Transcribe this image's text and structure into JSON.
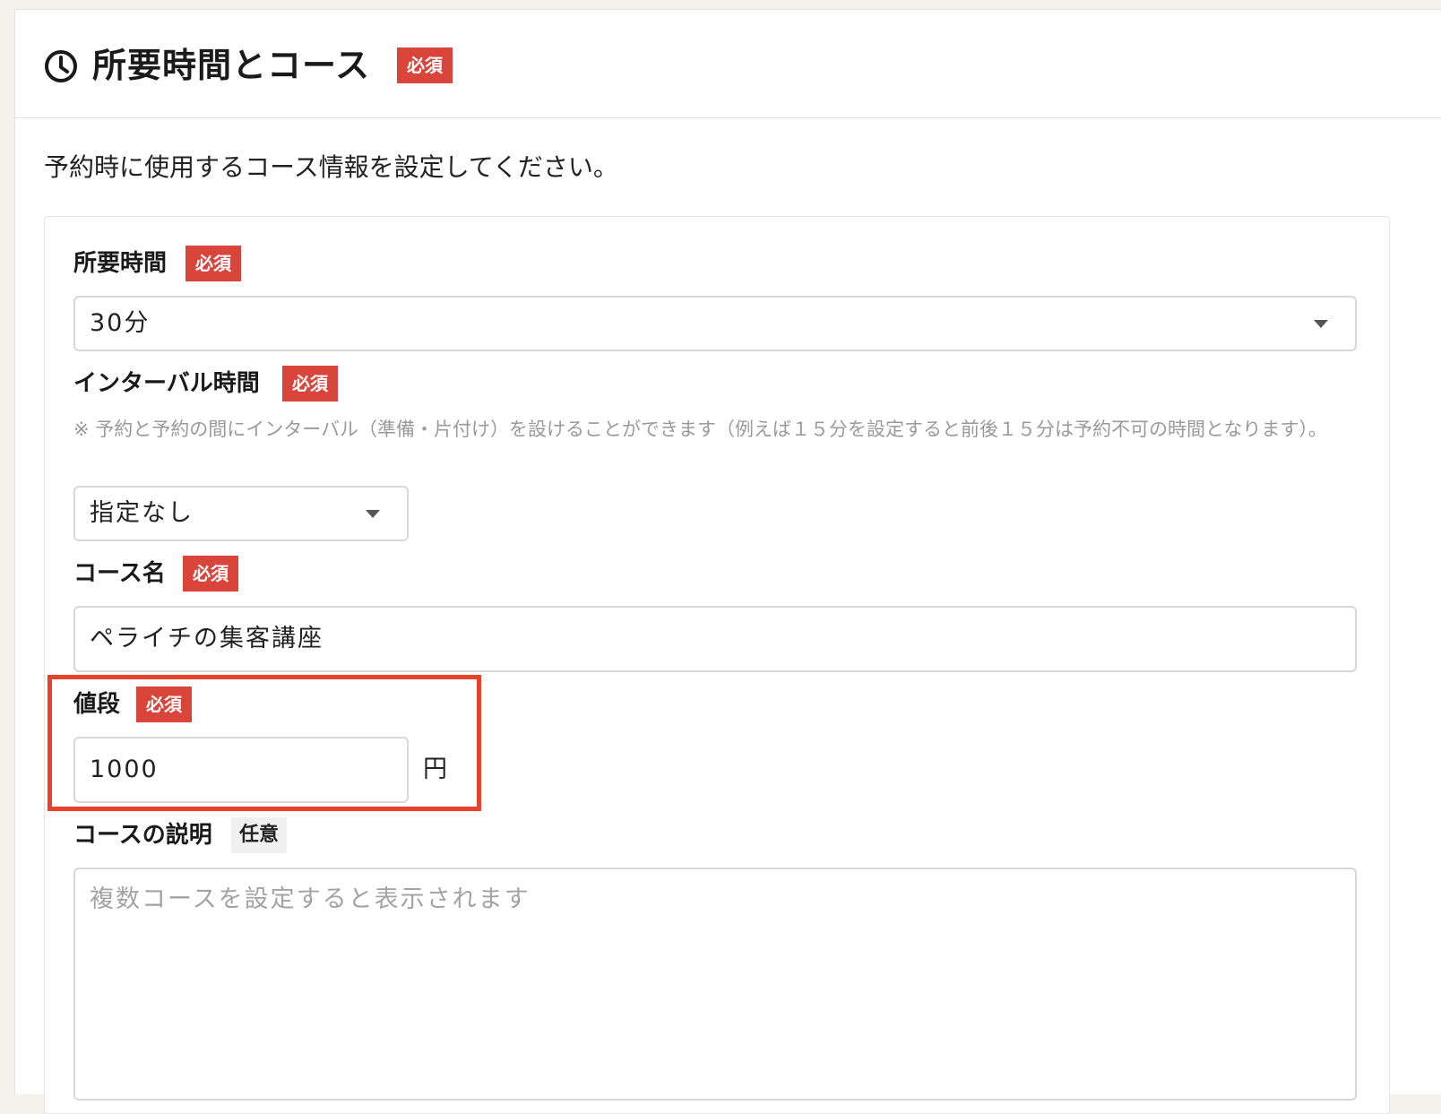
{
  "section": {
    "icon": "clock-icon",
    "title": "所要時間とコース",
    "required_badge": "必須",
    "intro": "予約時に使用するコース情報を設定してください。"
  },
  "fields": {
    "duration": {
      "label": "所要時間",
      "badge": "必須",
      "value": "30分"
    },
    "interval": {
      "label": "インターバル時間",
      "badge": "必須",
      "note": "※ 予約と予約の間にインターバル（準備・片付け）を設けることができます（例えば１５分を設定すると前後１５分は予約不可の時間となります）。",
      "value": "指定なし"
    },
    "course_name": {
      "label": "コース名",
      "badge": "必須",
      "value": "ペライチの集客講座"
    },
    "price": {
      "label": "値段",
      "badge": "必須",
      "value": "1000",
      "unit": "円"
    },
    "description": {
      "label": "コースの説明",
      "badge": "任意",
      "placeholder": "複数コースを設定すると表示されます"
    }
  },
  "colors": {
    "required_badge": "#d9453b",
    "highlight_border": "#e8412c",
    "page_background": "#f3f1ec",
    "placeholder_text": "#a3a3a3"
  }
}
